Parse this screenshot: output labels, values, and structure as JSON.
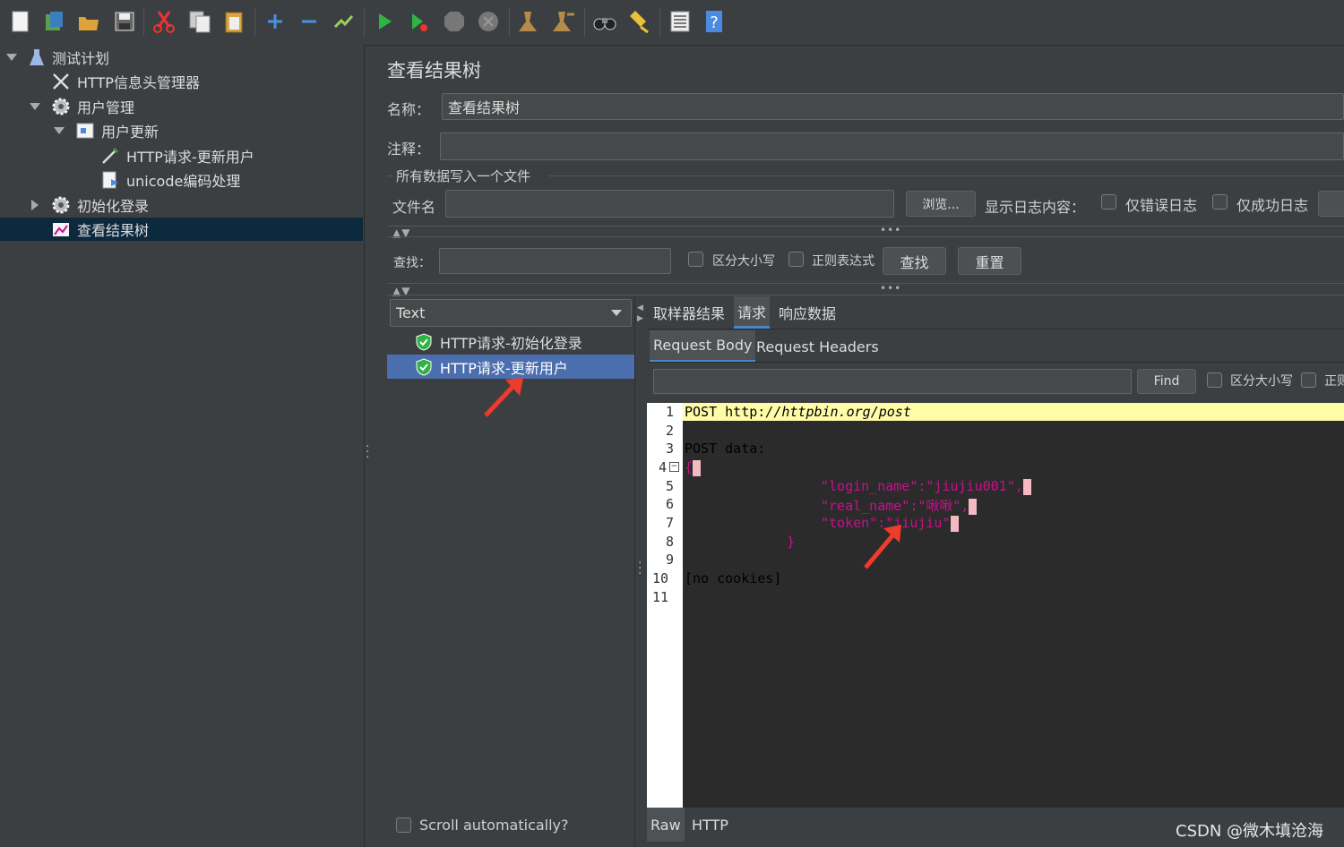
{
  "toolbar": {
    "icons": [
      "new-icon",
      "templates-icon",
      "open-icon",
      "save-icon",
      "cut-icon",
      "copy-icon",
      "paste-icon",
      "expand-icon",
      "collapse-icon",
      "toggle-icon",
      "start-icon",
      "start-no-pause-icon",
      "stop-icon",
      "shutdown-icon",
      "clear-icon",
      "clear-all-icon",
      "search-icon",
      "reset-search-icon",
      "function-helper-icon",
      "help-icon"
    ]
  },
  "tree": {
    "items": [
      {
        "label": "测试计划",
        "icon": "flask-icon"
      },
      {
        "label": "HTTP信息头管理器",
        "icon": "tools-icon"
      },
      {
        "label": "用户管理",
        "icon": "gear-icon"
      },
      {
        "label": "用户更新",
        "icon": "controller-icon"
      },
      {
        "label": "HTTP请求-更新用户",
        "icon": "pipette-icon"
      },
      {
        "label": "unicode编码处理",
        "icon": "script-icon"
      },
      {
        "label": "初始化登录",
        "icon": "gear-icon"
      },
      {
        "label": "查看结果树",
        "icon": "chart-icon"
      }
    ]
  },
  "panel": {
    "title": "查看结果树",
    "name_label": "名称：",
    "name_value": "查看结果树",
    "comment_label": "注释：",
    "comment_value": "",
    "file_section": "所有数据写入一个文件",
    "filename_label": "文件名",
    "browse_button": "浏览...",
    "log_label": "显示日志内容：",
    "errors_only": "仅错误日志",
    "success_only": "仅成功日志",
    "search_label": "查找：",
    "case_sensitive": "区分大小写",
    "regex": "正则表达式",
    "find_button": "查找",
    "reset_button": "重置"
  },
  "results": {
    "renderer": "Text",
    "items": [
      "HTTP请求-初始化登录",
      "HTTP请求-更新用户"
    ],
    "scroll_auto": "Scroll automatically?"
  },
  "detail": {
    "tabs": [
      "取样器结果",
      "请求",
      "响应数据"
    ],
    "subtabs": [
      "Request Body",
      "Request Headers"
    ],
    "find_button": "Find",
    "case_sensitive": "区分大小写",
    "regex_truncated": "正则",
    "bottom_tabs": [
      "Raw",
      "HTTP"
    ],
    "lines": [
      "1",
      "2",
      "3",
      "4",
      "5",
      "6",
      "7",
      "8",
      "9",
      "10",
      "11"
    ],
    "code": {
      "l1a": "POST http:",
      "l1b": "//httpbin.org/post",
      "l3": "POST data:",
      "l4": "{",
      "l5": "\"login_name\":\"jiujiu001\",",
      "l6": "\"real_name\":\"啾啾\",",
      "l7": "\"token\":\"jiujiu\"",
      "l8": "}",
      "l10": "[no cookies]"
    }
  },
  "watermark": "CSDN @微木填沧海",
  "colors": {
    "bg": "#3c3f41",
    "selected_tree": "#0d293e",
    "selected_result": "#4b6eaf",
    "json_pink": "#c8108c",
    "arrow_red": "#ee3b2b",
    "highlight_line": "#fffca8"
  }
}
